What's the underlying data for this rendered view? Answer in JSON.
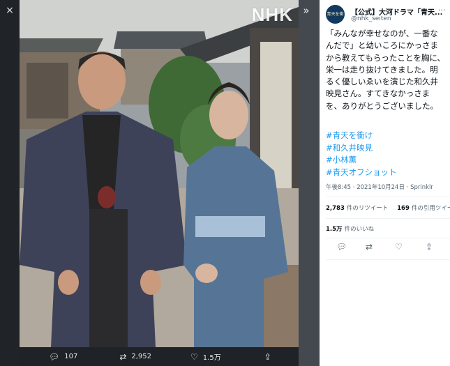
{
  "viewer": {
    "close_icon": "×",
    "expand_icon": "»",
    "watermark": "NHK"
  },
  "actions": {
    "reply_count": "107",
    "retweet_count": "2,952",
    "like_count": "1.5万"
  },
  "tweet": {
    "account_name": "【公式】大河ドラマ「青天...",
    "account_handle": "@nhk_seiten",
    "avatar_text": "青天を衝け",
    "text": "「みんなが幸せなのが、一番なんだで」と幼いころにかっさまから教えてもらったことを胸に、栄一は走り抜けてきました。明るく優しいゑいを演じた和久井映見さん。すてきなかっさまを、ありがとうございました。",
    "hashtags": [
      "#青天を衝け",
      "#和久井映見",
      "#小林薫",
      "#青天オフショット"
    ],
    "timestamp": "午後8:45 · 2021年10月24日 · Sprinklr",
    "retweets_value": "2,783",
    "retweets_label": "件のリツイート",
    "quotes_value": "169",
    "quotes_label": "件の引用ツイー",
    "likes_value": "1.5万",
    "likes_label": "件のいいね"
  }
}
